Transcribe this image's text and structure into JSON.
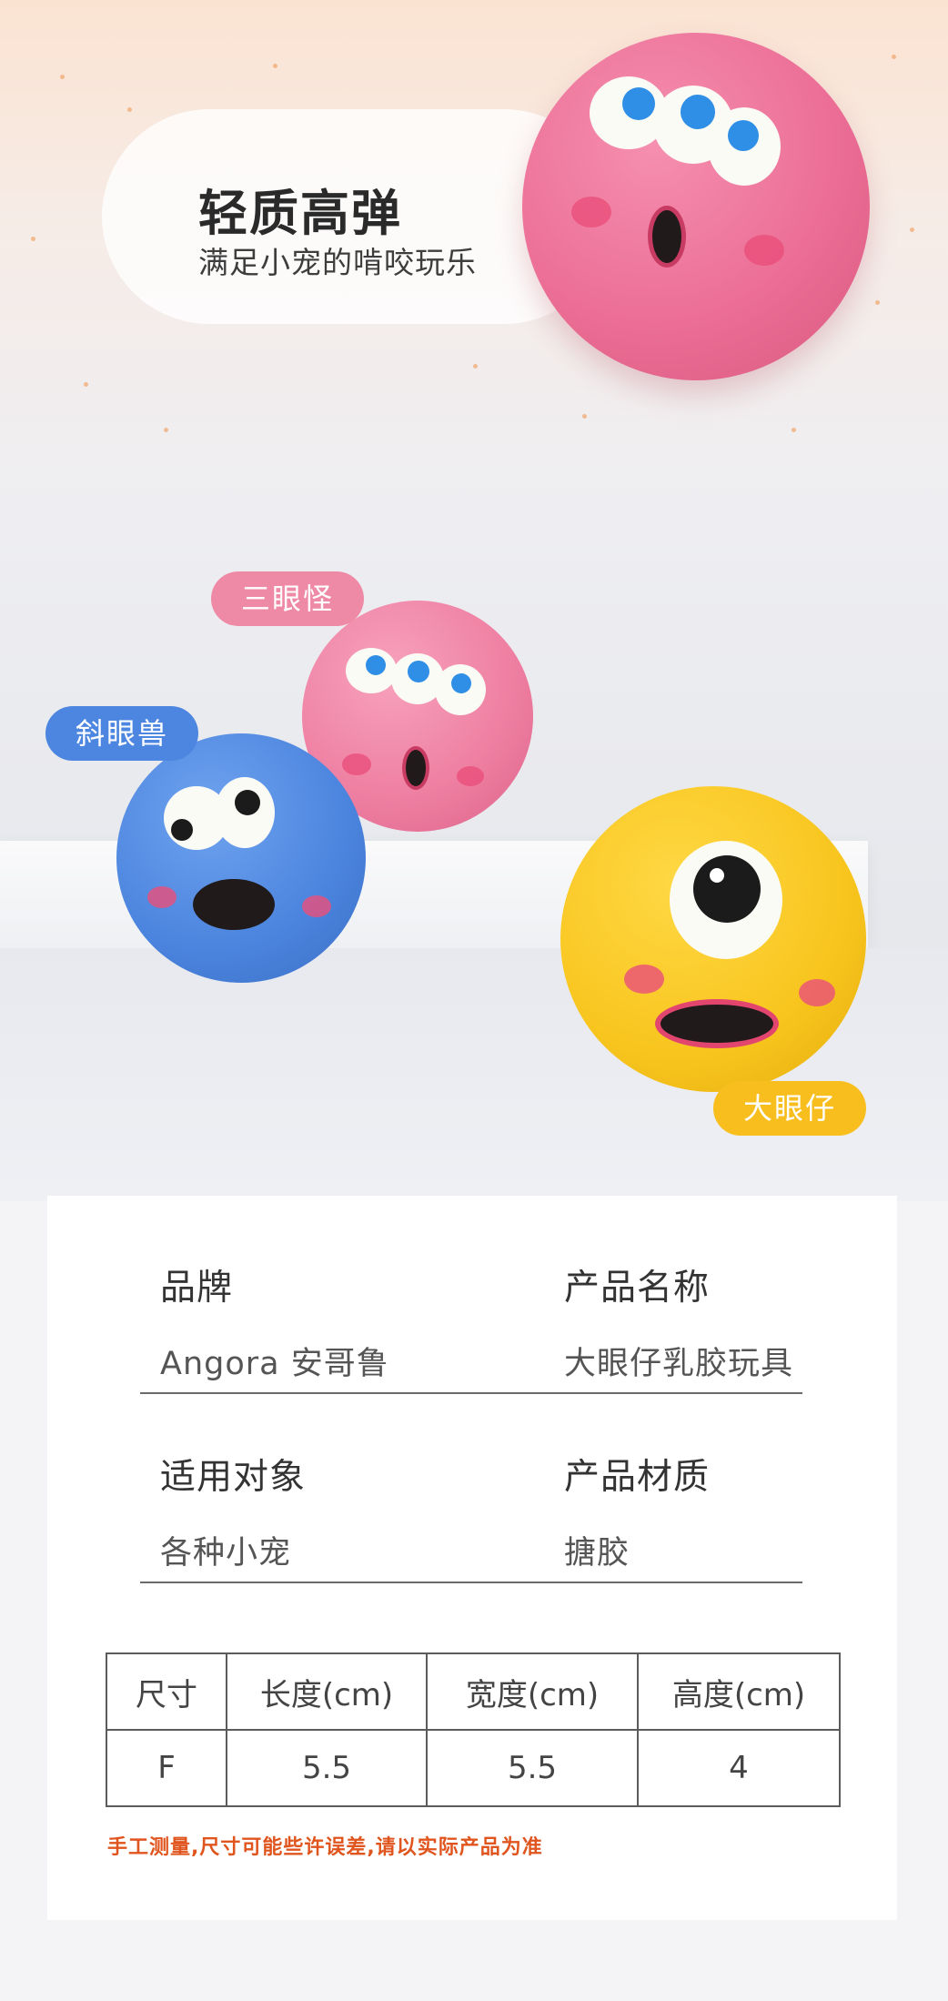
{
  "hero": {
    "title": "轻质高弹",
    "subtitle": "满足小宠的啃咬玩乐"
  },
  "tags": {
    "pink": "三眼怪",
    "blue": "斜眼兽",
    "yellow": "大眼仔"
  },
  "specs": {
    "brand_label": "品牌",
    "brand_value": "Angora 安哥鲁",
    "name_label": "产品名称",
    "name_value": "大眼仔乳胶玩具",
    "target_label": "适用对象",
    "target_value": "各种小宠",
    "material_label": "产品材质",
    "material_value": "搪胶"
  },
  "size_table": {
    "headers": [
      "尺寸",
      "长度(cm)",
      "宽度(cm)",
      "高度(cm)"
    ],
    "row": [
      "F",
      "5.5",
      "5.5",
      "4"
    ]
  },
  "note": "手工测量,尺寸可能些许误差,请以实际产品为准",
  "colors": {
    "pink_tag": "#ef8aa6",
    "blue_tag": "#4c86e0",
    "yellow_tag": "#f7be1e",
    "note_text": "#e0541e"
  }
}
